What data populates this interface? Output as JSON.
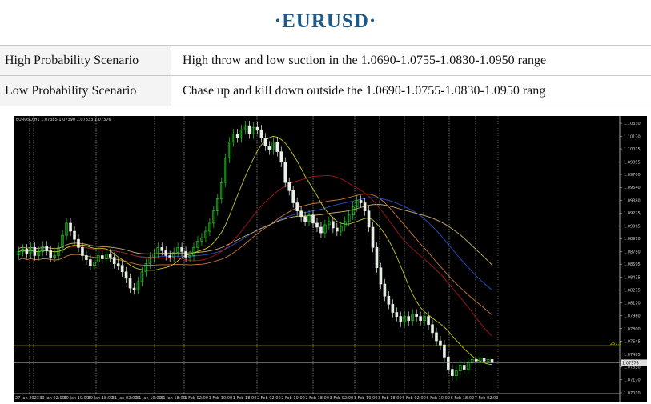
{
  "header": {
    "title": "·EURUSD·"
  },
  "scenarios": [
    {
      "label": "High Probability Scenario",
      "text": "High throw and low suction in the 1.0690-1.0755-1.0830-1.0950 range"
    },
    {
      "label": "Low Probability Scenario",
      "text": "Chase up and kill down outside the 1.0690-1.0755-1.0830-1.0950 rang"
    }
  ],
  "chart": {
    "info": "EURUSD,H1  1.07385 1.07390 1.07333 1.07376",
    "y_axis": {
      "min": 1.07,
      "max": 1.1038,
      "ticks": [
        "1.10330",
        "1.10170",
        "1.10015",
        "1.09855",
        "1.09700",
        "1.09540",
        "1.09380",
        "1.09225",
        "1.09065",
        "1.08910",
        "1.08750",
        "1.08595",
        "1.08435",
        "1.08275",
        "1.08120",
        "1.07960",
        "1.07800",
        "1.07645",
        "1.07485",
        "1.07330",
        "1.07170",
        "1.07010"
      ]
    },
    "x_axis_labels": [
      "27 Jan 2023",
      "30 Jan 02:00",
      "30 Jan 10:00",
      "30 Jan 18:00",
      "31 Jan 02:00",
      "31 Jan 10:00",
      "31 Jan 18:00",
      "1 Feb 02:00",
      "1 Feb 10:00",
      "1 Feb 18:00",
      "2 Feb 02:00",
      "2 Feb 10:00",
      "2 Feb 18:00",
      "3 Feb 02:00",
      "3 Feb 10:00",
      "3 Feb 18:00",
      "6 Feb 02:00",
      "6 Feb 10:00",
      "6 Feb 18:00",
      "7 Feb 02:00"
    ],
    "current_price": "1.07376",
    "level_line": {
      "value": 1.0759,
      "label": "261.8"
    },
    "colors": {
      "bull": "#22d822",
      "bear": "#e8f0e8",
      "ma_fast": "#c8c828",
      "ma_red": "#a81818",
      "ma_blue": "#2850c8",
      "ma_orange": "#c87838",
      "ma_tan": "#c8b070",
      "level": "#c8c820"
    },
    "close_path": [
      1.0875,
      1.0878,
      1.0872,
      1.088,
      1.087,
      1.0875,
      1.0882,
      1.0876,
      1.0868,
      1.087,
      1.088,
      1.0895,
      1.091,
      1.09,
      1.089,
      1.088,
      1.087,
      1.0865,
      1.0858,
      1.0862,
      1.087,
      1.0866,
      1.0872,
      1.0868,
      1.086,
      1.0858,
      1.085,
      1.0842,
      1.083,
      1.0828,
      1.0838,
      1.085,
      1.086,
      1.0868,
      1.0872,
      1.088,
      1.0876,
      1.087,
      1.0868,
      1.0874,
      1.088,
      1.0875,
      1.0868,
      1.087,
      1.088,
      1.0888,
      1.0892,
      1.09,
      1.091,
      1.0925,
      1.094,
      1.096,
      1.099,
      1.101,
      1.102,
      1.1015,
      1.1025,
      1.103,
      1.102,
      1.1028,
      1.1025,
      1.1015,
      1.1005,
      1.1,
      1.101,
      1.0998,
      1.0985,
      1.096,
      1.095,
      1.0935,
      1.0925,
      1.0918,
      1.0912,
      1.092,
      1.091,
      1.0905,
      1.0898,
      1.0908,
      1.0912,
      1.0904,
      1.09,
      1.0906,
      1.0912,
      1.092,
      1.093,
      1.0938,
      1.0935,
      1.0925,
      1.0905,
      1.088,
      1.0855,
      1.0835,
      1.082,
      1.081,
      1.08,
      1.0795,
      1.0788,
      1.0795,
      1.079,
      1.0798,
      1.0795,
      1.079,
      1.0795,
      1.0785,
      1.0775,
      1.0765,
      1.076,
      1.0745,
      1.073,
      1.0722,
      1.0728,
      1.0735,
      1.073,
      1.0738,
      1.0742,
      1.074,
      1.0744,
      1.074,
      1.0742,
      1.0738
    ]
  }
}
